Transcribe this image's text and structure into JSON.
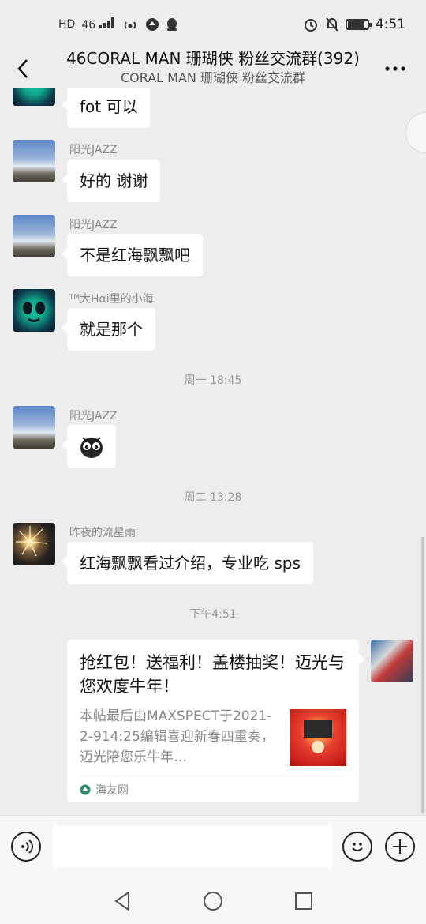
{
  "status_bar": {
    "left_icons": [
      "hd-icon",
      "signal-4g-icon",
      "hotspot-icon",
      "app-icon",
      "qq-icon"
    ],
    "hd_label": "HD",
    "network_label": "46",
    "time": "4:51"
  },
  "header": {
    "title": "46CORAL MAN 珊瑚侠 粉丝交流群(392)",
    "subtitle": "CORAL MAN 珊瑚侠 粉丝交流群"
  },
  "messages": [
    {
      "type": "text",
      "sender": "",
      "text": "fot 可以",
      "avatar": "alien"
    },
    {
      "type": "text",
      "sender": "阳光JAZZ",
      "text": "好的 谢谢",
      "avatar": "sky"
    },
    {
      "type": "text",
      "sender": "阳光JAZZ",
      "text": "不是红海飘飘吧",
      "avatar": "sky"
    },
    {
      "type": "text",
      "sender": "ᵀᴹ大Hαⅰ里的小海",
      "text": "就是那个",
      "avatar": "alien"
    },
    {
      "type": "time",
      "text": "周一 18:45"
    },
    {
      "type": "sticker",
      "sender": "阳光JAZZ",
      "avatar": "sky"
    },
    {
      "type": "time",
      "text": "周二 13:28"
    },
    {
      "type": "text",
      "sender": "昨夜的流星雨",
      "text": "红海飘飘看过介绍，专业吃 sps",
      "avatar": "spark"
    },
    {
      "type": "time",
      "text": "下午4:51"
    },
    {
      "type": "card",
      "title": "抢红包！送福利！盖楼抽奖！迈光与您欢度牛年！",
      "desc": "本帖最后由MAXSPECT于2021-2-914:25编辑喜迎新春四重奏，迈光陪您乐牛年…",
      "source": "海友网"
    }
  ],
  "input": {
    "value": "",
    "placeholder": ""
  },
  "colors": {
    "background": "#ededed",
    "bubble": "#ffffff",
    "meta_text": "#999999"
  }
}
